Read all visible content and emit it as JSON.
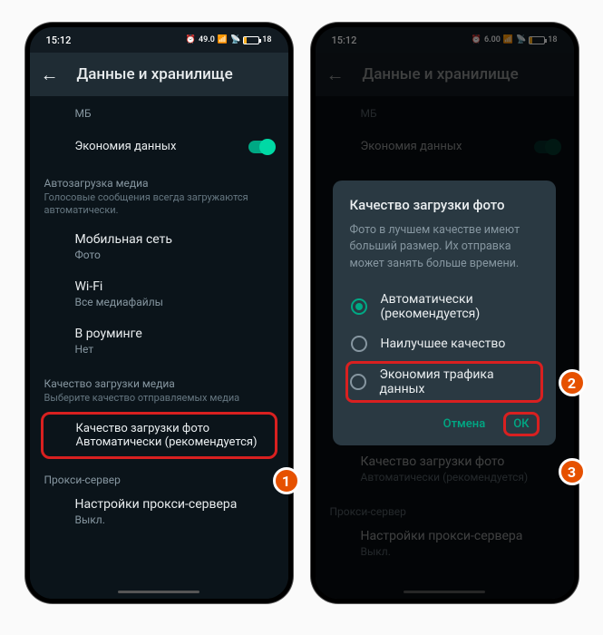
{
  "status": {
    "time": "15:12",
    "net": "49.0",
    "net2": "6.00",
    "battery": "18"
  },
  "appbar": {
    "title": "Данные и хранилище"
  },
  "partial_row": {
    "sub": "МБ"
  },
  "data_saver": {
    "label": "Экономия данных"
  },
  "autoload": {
    "header": "Автозагрузка медиа",
    "note": "Голосовые сообщения всегда загружаются автоматически.",
    "mobile": {
      "label": "Мобильная сеть",
      "sub": "Фото"
    },
    "wifi": {
      "label": "Wi-Fi",
      "sub": "Все медиафайлы"
    },
    "roaming": {
      "label": "В роуминге",
      "sub": "Нет"
    }
  },
  "quality": {
    "header": "Качество загрузки медиа",
    "note": "Выберите качество отправляемых медиа",
    "item": {
      "label": "Качество загрузки фото",
      "sub": "Автоматически (рекомендуется)"
    }
  },
  "proxy": {
    "header": "Прокси-сервер",
    "item": {
      "label": "Настройки прокси-сервера",
      "sub": "Выкл."
    }
  },
  "dialog": {
    "title": "Качество загрузки фото",
    "body": "Фото в лучшем качестве имеют больший размер. Их отправка может занять больше времени.",
    "opt1": "Автоматически (рекомендуется)",
    "opt2": "Наилучшее качество",
    "opt3": "Экономия трафика данных",
    "cancel": "Отмена",
    "ok": "ОК"
  },
  "badges": {
    "b1": "1",
    "b2": "2",
    "b3": "3"
  }
}
